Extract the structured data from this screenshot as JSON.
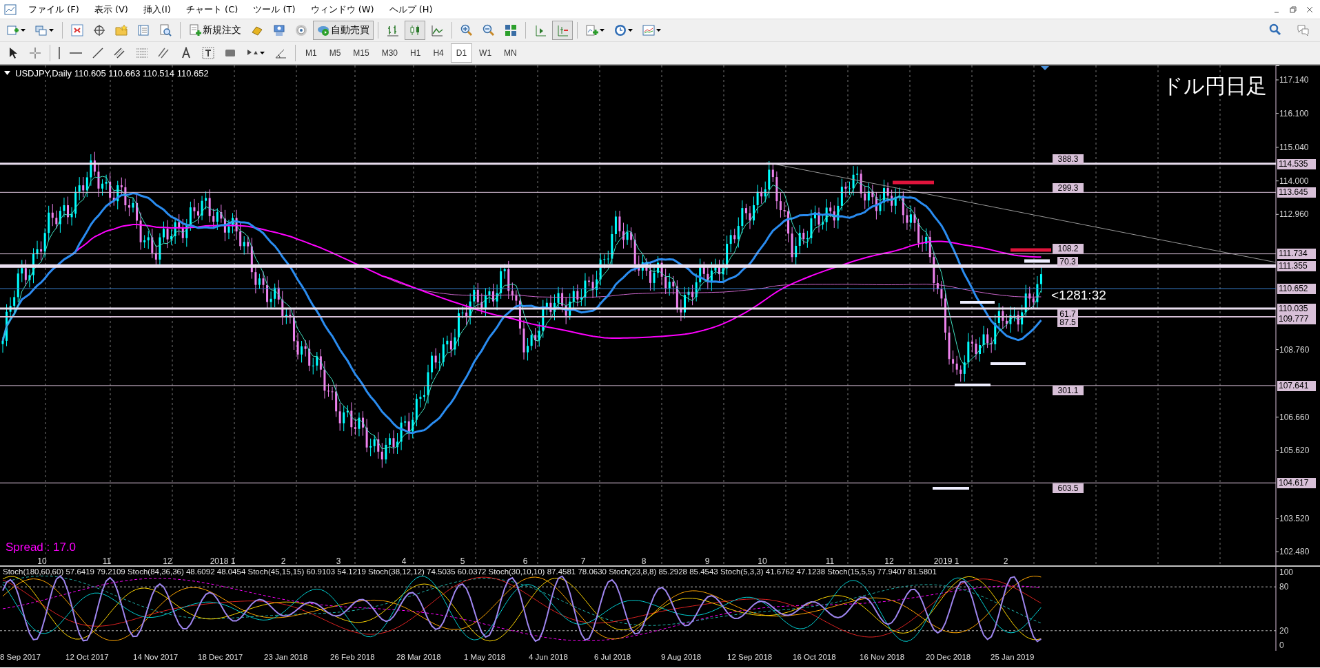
{
  "menu": [
    "ファイル (F)",
    "表示 (V)",
    "挿入(I)",
    "チャート (C)",
    "ツール (T)",
    "ウィンドウ (W)",
    "ヘルプ (H)"
  ],
  "toolbar": {
    "buttons": [
      {
        "label": "新規注文"
      },
      {
        "label": "自動売買"
      }
    ],
    "chart_types": [
      {
        "kind": "bar",
        "selected": false
      },
      {
        "kind": "candlestick",
        "selected": true
      },
      {
        "kind": "line",
        "selected": false
      }
    ],
    "chart_shift": {
      "selected": false
    },
    "auto_scroll": {
      "selected": true
    }
  },
  "timeframes": [
    {
      "label": "M1",
      "selected": false
    },
    {
      "label": "M5",
      "selected": false
    },
    {
      "label": "M15",
      "selected": false
    },
    {
      "label": "M30",
      "selected": false
    },
    {
      "label": "H1",
      "selected": false
    },
    {
      "label": "H4",
      "selected": false
    },
    {
      "label": "D1",
      "selected": true
    },
    {
      "label": "W1",
      "selected": false
    },
    {
      "label": "MN",
      "selected": false
    }
  ],
  "chart": {
    "header": "USDJPY,Daily  110.605 110.663 110.514 110.652",
    "title": "ドル円日足",
    "countdown": "<1281:32",
    "spread": "Spread : 17.0",
    "price_ticks": [
      "117.140",
      "116.100",
      "115.040",
      "114.000",
      "112.960",
      "108.760",
      "106.660",
      "105.620",
      "103.520",
      "102.480"
    ],
    "levels": [
      {
        "kind": "level",
        "price": "114.535",
        "tag": "388.3"
      },
      {
        "kind": "level",
        "price": "113.645",
        "tag": "299.3"
      },
      {
        "kind": "level",
        "price": "111.734",
        "tag": "108.2"
      },
      {
        "kind": "level",
        "price": "111.355",
        "tag": "70.3"
      },
      {
        "kind": "bid",
        "price": "110.652"
      },
      {
        "kind": "level",
        "price": "110.035",
        "tag": "61.7"
      },
      {
        "kind": "level",
        "price": "109.777",
        "tag": "87.5"
      },
      {
        "kind": "level",
        "price": "107.641",
        "tag": "301.1"
      },
      {
        "kind": "level",
        "price": "104.617",
        "tag": "603.5"
      }
    ],
    "month_labels": [
      "10",
      "11",
      "12",
      "2018 1",
      "2",
      "3",
      "4",
      "5",
      "6",
      "7",
      "8",
      "9",
      "10",
      "11",
      "12",
      "2019 1",
      "2"
    ]
  },
  "oscillator": {
    "legend": "Stoch(180,60,60) 57.6419 79.2109  Stoch(84,36,36) 48.6092 48.0454  Stoch(45,15,15) 60.9103 54.1219  Stoch(38,12,12) 74.5035 60.0372  Stoch(30,10,10) 87.4581 78.0630  Stoch(23,8,8) 85.2928 85.4543  Stoch(5,3,3) 41.6762 47.1238  Stoch(15,5,5) 77.9407 81.5801",
    "scale": [
      "100",
      "80",
      "20",
      "0"
    ]
  },
  "dates": [
    "8 Sep 2017",
    "12 Oct 2017",
    "14 Nov 2017",
    "18 Dec 2017",
    "23 Jan 2018",
    "26 Feb 2018",
    "28 Mar 2018",
    "1 May 2018",
    "4 Jun 2018",
    "6 Jul 2018",
    "9 Aug 2018",
    "12 Sep 2018",
    "16 Oct 2018",
    "16 Nov 2018",
    "20 Dec 2018",
    "25 Jan 2019"
  ]
}
